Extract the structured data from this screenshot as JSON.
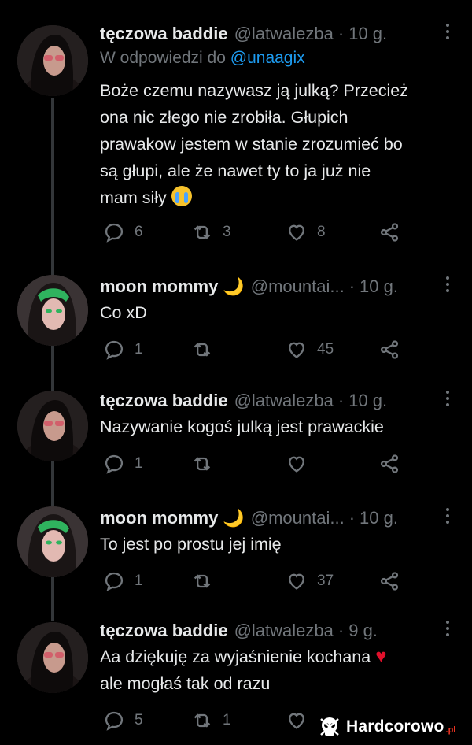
{
  "tweets": [
    {
      "name": "tęczowa baddie",
      "moon": "",
      "handle": "@latwalezba",
      "separator": "·",
      "time": "10 g.",
      "reply_to_prefix": "W odpowiedzi do",
      "reply_to_mention": "@unaagix",
      "text_lines": [
        "Boże czemu nazywasz ją julką? Przecież",
        "ona nic złego nie zrobiła. Głupich",
        "prawakow jestem w stanie zrozumieć bo",
        "są głupi, ale że nawet ty to ja już nie",
        "mam siły"
      ],
      "replies": "6",
      "retweets": "3",
      "likes": "8"
    },
    {
      "name": "moon mommy",
      "moon": "🌙",
      "handle": "@mountai...",
      "separator": "·",
      "time": "10 g.",
      "text_lines": [
        "Co xD"
      ],
      "replies": "1",
      "retweets": "",
      "likes": "45"
    },
    {
      "name": "tęczowa baddie",
      "moon": "",
      "handle": "@latwalezba",
      "separator": "·",
      "time": "10 g.",
      "text_lines": [
        "Nazywanie kogoś julką jest prawackie"
      ],
      "replies": "1",
      "retweets": "",
      "likes": ""
    },
    {
      "name": "moon mommy",
      "moon": "🌙",
      "handle": "@mountai...",
      "separator": "·",
      "time": "10 g.",
      "text_lines": [
        "To jest po prostu jej imię"
      ],
      "replies": "1",
      "retweets": "",
      "likes": "37"
    },
    {
      "name": "tęczowa baddie",
      "moon": "",
      "handle": "@latwalezba",
      "separator": "·",
      "time": "9 g.",
      "text_lines": [
        "Aa dziękuję za wyjaśnienie kochana",
        "ale mogłaś tak od razu"
      ],
      "replies": "5",
      "retweets": "1",
      "likes": ""
    }
  ],
  "watermark": {
    "text": "Hardcorowo",
    "tld": ".pl"
  },
  "colors": {
    "background": "#000000",
    "text": "#e7e9ea",
    "muted": "#71767b",
    "link": "#1d9bf0",
    "heart_emoji": "#e0102b"
  },
  "icons": {
    "reply": "reply-icon",
    "retweet": "retweet-icon",
    "like": "like-icon",
    "share": "share-icon",
    "more": "more-icon",
    "crying_emoji": "loudly-crying-face-emoji",
    "heart_emoji": "red-heart-emoji",
    "moon_emoji": "crescent-moon-emoji"
  }
}
